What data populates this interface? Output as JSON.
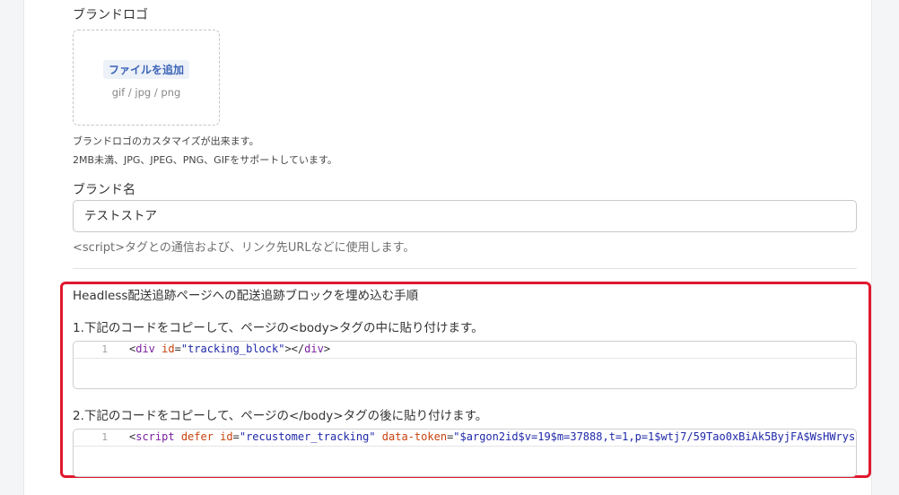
{
  "brand_logo": {
    "label": "ブランドロゴ",
    "add_file_button": "ファイルを追加",
    "file_types": "gif / jpg / png",
    "help_line1": "ブランドロゴのカスタマイズが出来ます。",
    "help_line2": "2MB未満、JPG、JPEG、PNG、GIFをサポートしています。"
  },
  "brand_name": {
    "label": "ブランド名",
    "value": "テストストア",
    "hint": "<script>タグとの通信および、リンク先URLなどに使用します。"
  },
  "headless": {
    "title": "Headless配送追跡ページへの配送追跡ブロックを埋め込む手順",
    "step1": "1.下記のコードをコピーして、ページの<body>タグの中に貼り付けます。",
    "step2": "2.下記のコードをコピーして、ページの</body>タグの後に貼り付けます。",
    "code1": {
      "line_number": "1",
      "open": "<",
      "tag": "div",
      "attr": " id",
      "eq": "=",
      "value": "\"tracking_block\"",
      "close": "></",
      "end_tag": "div",
      "end": ">"
    },
    "code2": {
      "line_number": "1",
      "open": "<",
      "tag": "script",
      "attr1": " defer id",
      "eq1": "=",
      "value1": "\"recustomer_tracking\"",
      "attr2": " data-token",
      "eq2": "=",
      "value2": "\"$argon2id$v=19$m=37888,t=1,p=1$wtj7/59Tao0xBiAk5ByjFA$WsHWrys"
    }
  },
  "colors": {
    "highlight_border": "#e0182e",
    "add_file_text": "#3b64b7",
    "code_tag": "#7a1f9e",
    "code_attr": "#c9420e",
    "code_string": "#1e28a8"
  }
}
